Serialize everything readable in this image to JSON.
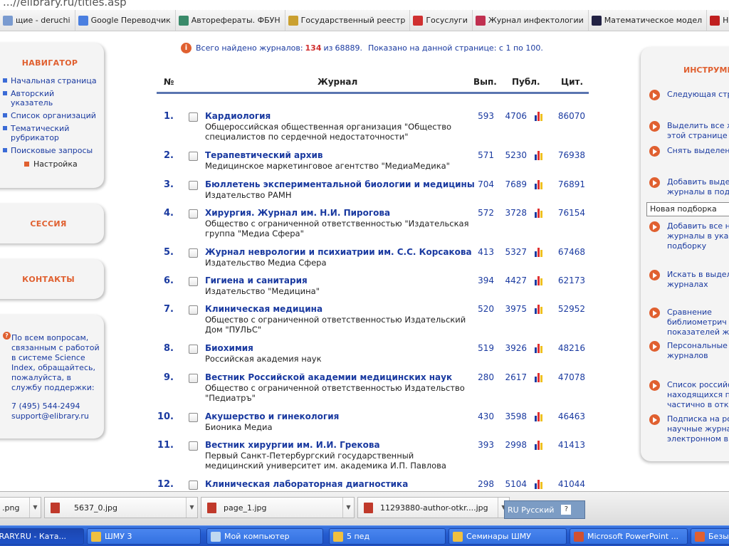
{
  "browser": {
    "url_fragment": "...//elibrary.ru/titles.asp",
    "bookmarks": [
      {
        "label": "щие - deruchi",
        "icon": "page-icon",
        "color": "#7a9bd0"
      },
      {
        "label": "Google Переводчик",
        "icon": "google-translate-icon",
        "color": "#4a7fe0"
      },
      {
        "label": "Авторефераты. ФБУН",
        "icon": "cs-logo-icon",
        "color": "#3a8a6a"
      },
      {
        "label": "Государственный реестр",
        "icon": "emblem-icon",
        "color": "#caa030"
      },
      {
        "label": "Госуслуги",
        "icon": "flag-icon",
        "color": "#d03030"
      },
      {
        "label": "Журнал инфектологии",
        "icon": "book-icon",
        "color": "#c03050"
      },
      {
        "label": "Математическое модел",
        "icon": "o-logo-icon",
        "color": "#222244"
      },
      {
        "label": "Натуральн",
        "icon": "cube-icon",
        "color": "#c02020"
      }
    ]
  },
  "left": {
    "navigator_title": "НАВИГАТОР",
    "nav_items": [
      "Начальная страница",
      "Авторский указатель",
      "Список организаций",
      "Тематический рубрикатор",
      "Поисковые запросы"
    ],
    "settings_label": "Настройка",
    "session_title": "СЕССИЯ",
    "contacts_title": "КОНТАКТЫ",
    "help_lines": [
      "По всем вопросам,",
      "связанным с работой",
      "в системе Science",
      "Index, обращайтесь,",
      "пожалуйста, в",
      "службу поддержки:"
    ],
    "phone": "7 (495) 544-2494",
    "email": "support@elibrary.ru"
  },
  "summary": {
    "prefix": "Всего найдено журналов:",
    "found": "134",
    "of_word": "из",
    "total": "68889.",
    "shown": "Показано на данной странице: с 1 по 100."
  },
  "table": {
    "headers": {
      "num": "№",
      "journal": "Журнал",
      "issues": "Вып.",
      "pubs": "Публ.",
      "cites": "Цит."
    },
    "rows": [
      {
        "num": "1.",
        "title": "Кардиология",
        "publisher": "Общероссийская общественная организация \"Общество специалистов по сердечной недостаточности\"",
        "issues": "593",
        "pubs": "4706",
        "cites": "86070"
      },
      {
        "num": "2.",
        "title": "Терапевтический архив",
        "publisher": "Медицинское маркетинговое агентство \"МедиаМедика\"",
        "issues": "571",
        "pubs": "5230",
        "cites": "76938"
      },
      {
        "num": "3.",
        "title": "Бюллетень экспериментальной биологии и медицины",
        "publisher": "Издательство РАМН",
        "issues": "704",
        "pubs": "7689",
        "cites": "76891"
      },
      {
        "num": "4.",
        "title": "Хирургия. Журнал им. Н.И. Пирогова",
        "publisher": "Общество с ограниченной ответственностью \"Издательская группа \"Медиа Сфера\"",
        "issues": "572",
        "pubs": "3728",
        "cites": "76154"
      },
      {
        "num": "5.",
        "title": "Журнал неврологии и психиатрии им. С.С. Корсакова",
        "publisher": "Издательство Медиа Сфера",
        "issues": "413",
        "pubs": "5327",
        "cites": "67468"
      },
      {
        "num": "6.",
        "title": "Гигиена и санитария",
        "publisher": "Издательство \"Медицина\"",
        "issues": "394",
        "pubs": "4427",
        "cites": "62173"
      },
      {
        "num": "7.",
        "title": "Клиническая медицина",
        "publisher": "Общество с ограниченной ответственностью Издательский Дом \"ПУЛЬС\"",
        "issues": "520",
        "pubs": "3975",
        "cites": "52952"
      },
      {
        "num": "8.",
        "title": "Биохимия",
        "publisher": "Российская академия наук",
        "issues": "519",
        "pubs": "3926",
        "cites": "48216"
      },
      {
        "num": "9.",
        "title": "Вестник Российской академии медицинских наук",
        "publisher": "Общество с ограниченной ответственностью Издательство \"Педиатръ\"",
        "issues": "280",
        "pubs": "2617",
        "cites": "47078"
      },
      {
        "num": "10.",
        "title": "Акушерство и гинекология",
        "publisher": "Бионика Медиа",
        "issues": "430",
        "pubs": "3598",
        "cites": "46463"
      },
      {
        "num": "11.",
        "title": "Вестник хирургии им. И.И. Грекова",
        "publisher": "Первый Санкт-Петербургский государственный медицинский университет им. академика И.П. Павлова",
        "issues": "393",
        "pubs": "2998",
        "cites": "41413"
      },
      {
        "num": "12.",
        "title": "Клиническая лабораторная диагностика",
        "publisher": "",
        "issues": "298",
        "pubs": "5104",
        "cites": "41044"
      }
    ]
  },
  "right": {
    "title": "ИНСТРУМЕ",
    "items": [
      {
        "lines": [
          "Следующая стр"
        ]
      },
      {
        "lines": [
          "Выделить все ж",
          "этой странице"
        ]
      },
      {
        "lines": [
          "Снять выделен"
        ]
      },
      {
        "lines": [
          "Добавить выде",
          "журналы в подб"
        ]
      },
      {
        "lines": [
          "Добавить все н",
          "журналы в указ",
          "подборку"
        ]
      },
      {
        "lines": [
          "Искать в выдел",
          "журналах"
        ]
      },
      {
        "lines": [
          "Сравнение",
          "библиометрич",
          "показателей жу"
        ]
      },
      {
        "lines": [
          "Персональные",
          "журналов"
        ]
      },
      {
        "lines": [
          "Список российс",
          "находящихся п",
          "частично в откр"
        ]
      },
      {
        "lines": [
          "Подписка на ро",
          "научные журна",
          "электронном ви"
        ]
      }
    ],
    "select_value": "Новая подборка"
  },
  "downloads": {
    "items": [
      ".png",
      "5637_0.jpg",
      "page_1.jpg",
      "11293880-author-otkr....jpg"
    ],
    "lang": "RU Русский",
    "help": "?"
  },
  "taskbar": {
    "items": [
      {
        "label": "BRARY.RU - Ката...",
        "color": "#e06030"
      },
      {
        "label": "ШМУ 3",
        "color": "#f0c040"
      },
      {
        "label": "Мой компьютер",
        "color": "#c0d8f0"
      },
      {
        "label": "5 пед",
        "color": "#f0c040"
      },
      {
        "label": "Семинары ШМУ",
        "color": "#f0c040"
      },
      {
        "label": "Microsoft PowerPoint ...",
        "color": "#d05030"
      },
      {
        "label": "Безы",
        "color": "#e06030"
      }
    ]
  }
}
